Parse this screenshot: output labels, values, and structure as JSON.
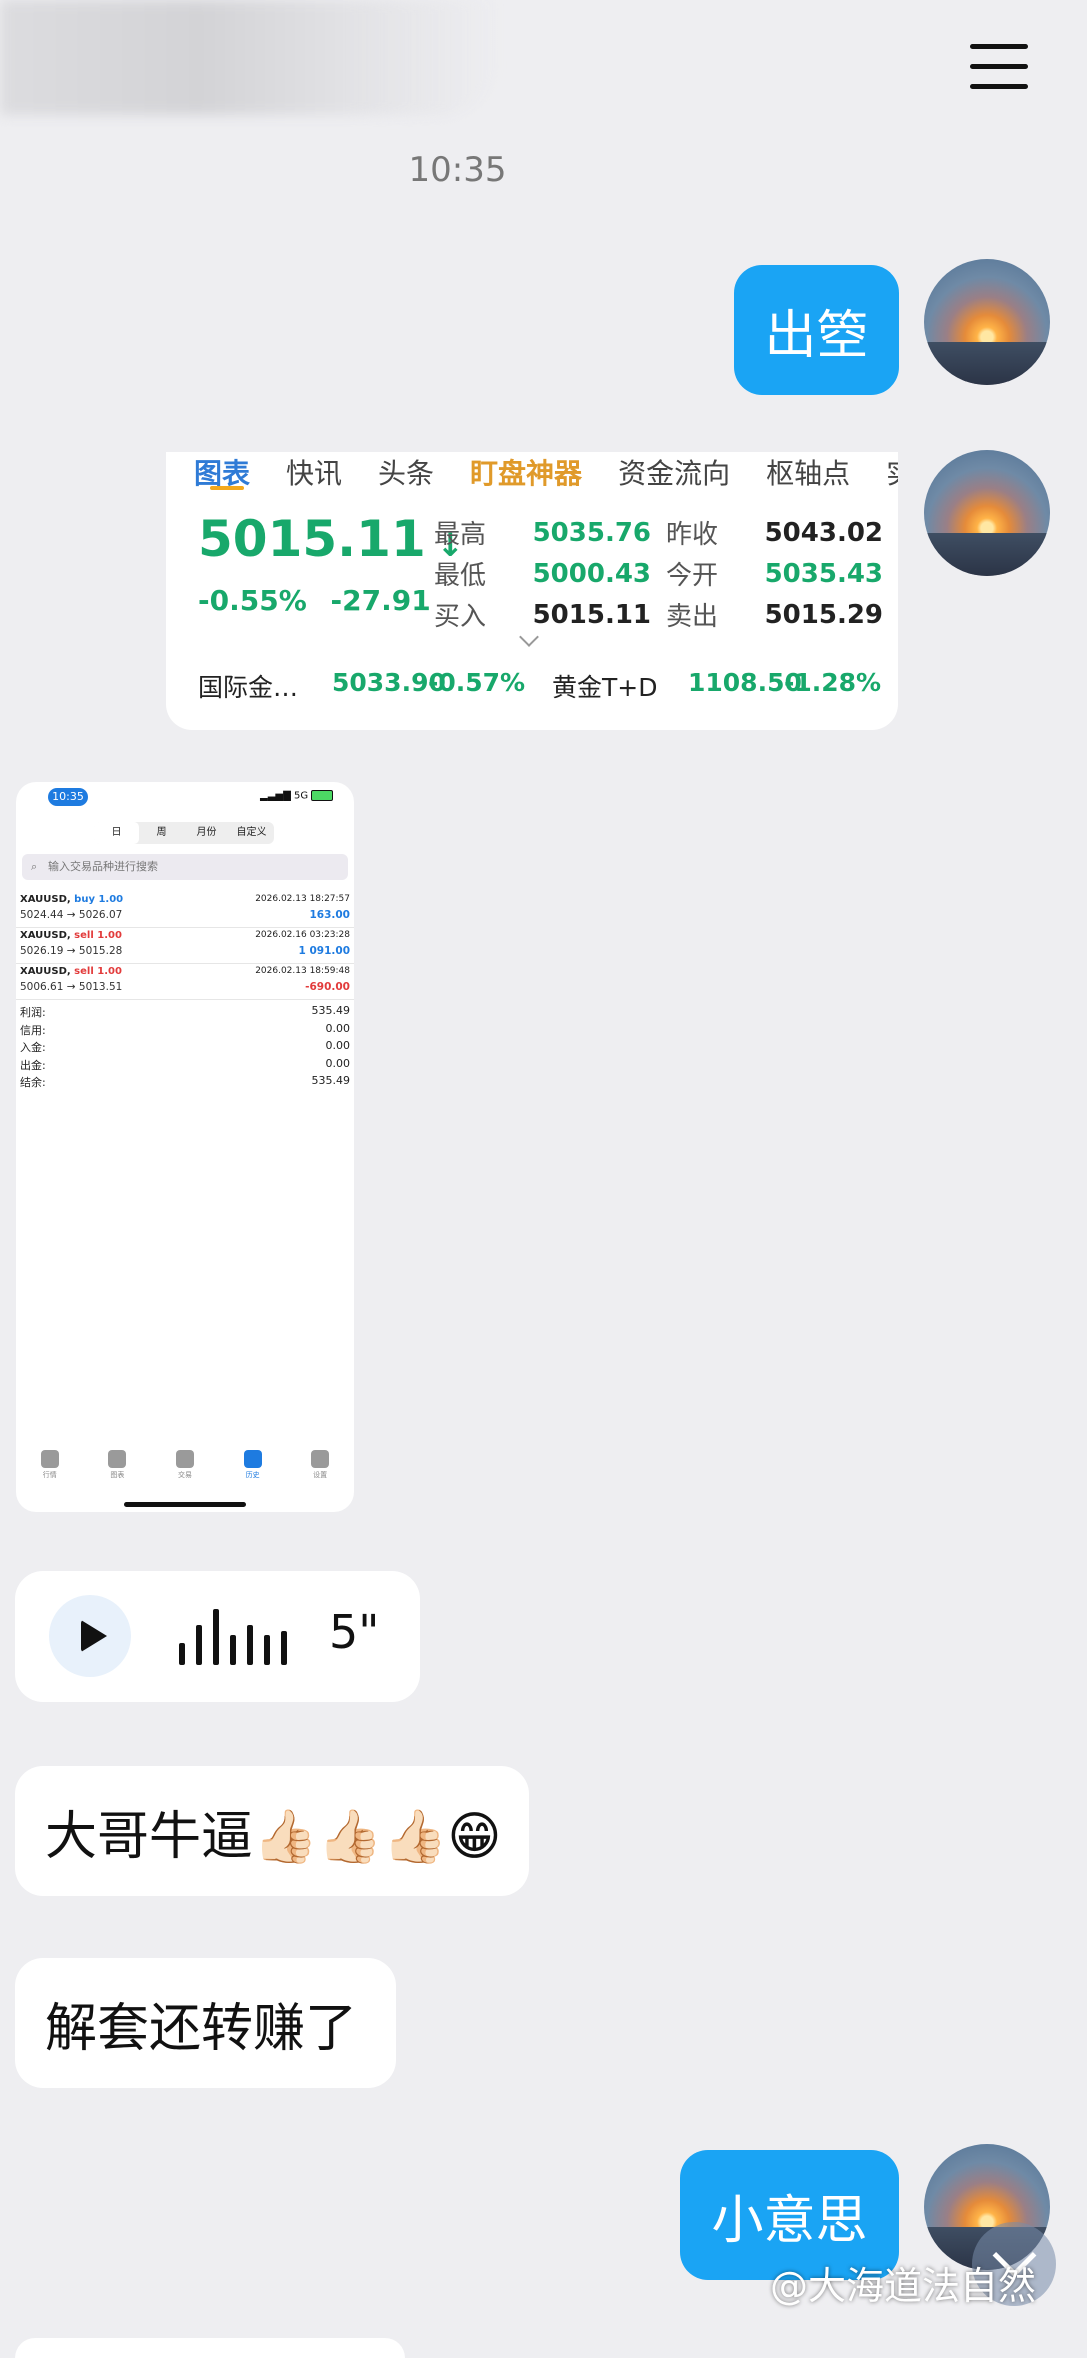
{
  "header": {
    "menu_icon": "hamburger-icon"
  },
  "timestamp": "10:35",
  "messages": {
    "m1": {
      "text": "出箜"
    },
    "m_voice": {
      "duration": "5\""
    },
    "m2": {
      "text": "大哥牛逼👍🏻👍🏻👍🏻😁"
    },
    "m3": {
      "text": "解套还转赚了"
    },
    "m4": {
      "text": "小意思"
    }
  },
  "quote": {
    "tabs": [
      "图表",
      "快讯",
      "头条",
      "盯盘神器",
      "资金流向",
      "枢轴点",
      "实"
    ],
    "price": "5015.11",
    "change_pct": "-0.55%",
    "change_abs": "-27.91",
    "rows": [
      {
        "l1": "最高",
        "v1": "5035.76",
        "l2": "昨收",
        "v2": "5043.02"
      },
      {
        "l1": "最低",
        "v1": "5000.43",
        "l2": "今开",
        "v2": "5035.43"
      },
      {
        "l1": "买入",
        "v1": "5015.11",
        "l2": "卖出",
        "v2": "5015.29"
      }
    ],
    "bottom": {
      "name1": "国际金…",
      "price1": "5033.90",
      "pct1": "-0.57%",
      "name2": "黄金T+D",
      "price2": "1108.50",
      "pct2": "-1.28%"
    }
  },
  "phone": {
    "time": "10:35",
    "status": "5G",
    "segments": [
      "日",
      "周",
      "月份",
      "自定义"
    ],
    "search_placeholder": "输入交易品种进行搜索",
    "trades": [
      {
        "symbol": "XAUUSD,",
        "side": "buy 1.00",
        "datetime": "2026.02.13 18:27:57",
        "prices": "5024.44 → 5026.07",
        "pl": "163.00"
      },
      {
        "symbol": "XAUUSD,",
        "side": "sell 1.00",
        "datetime": "2026.02.16 03:23:28",
        "prices": "5026.19 → 5015.28",
        "pl": "1 091.00"
      },
      {
        "symbol": "XAUUSD,",
        "side": "sell 1.00",
        "datetime": "2026.02.13 18:59:48",
        "prices": "5006.61 → 5013.51",
        "pl": "-690.00"
      }
    ],
    "summary": [
      {
        "label": "利润:",
        "value": "535.49"
      },
      {
        "label": "信用:",
        "value": "0.00"
      },
      {
        "label": "入金:",
        "value": "0.00"
      },
      {
        "label": "出金:",
        "value": "0.00"
      },
      {
        "label": "结余:",
        "value": "535.49"
      }
    ],
    "nav": [
      "行情",
      "图表",
      "交易",
      "历史",
      "设置"
    ]
  },
  "watermark": "@大海道法自然",
  "colors": {
    "bubble_blue": "#1aa4f4",
    "up_green": "#18a86b",
    "loss_red": "#e23b3b"
  }
}
